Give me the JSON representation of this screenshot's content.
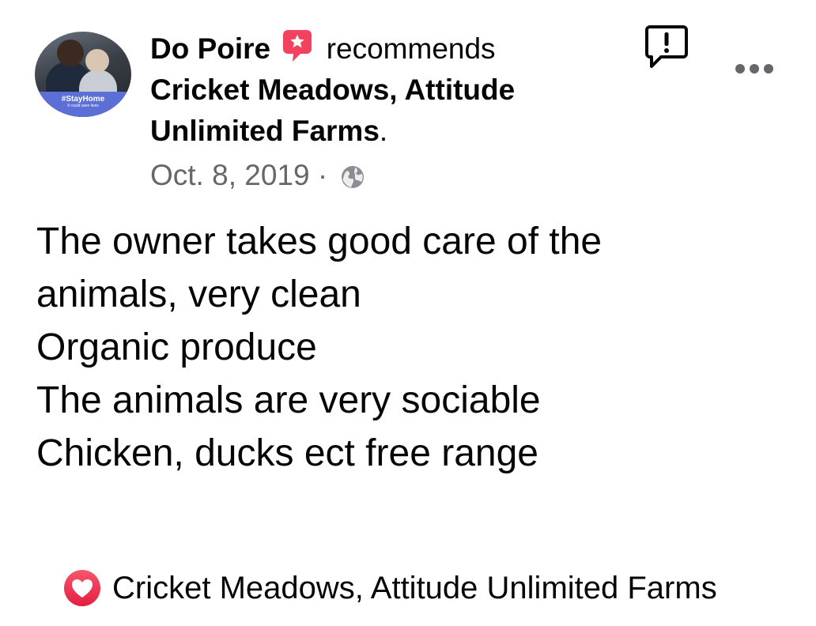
{
  "post": {
    "author": "Do Poire",
    "action": "recommends",
    "page_name": "Cricket Meadows, Attitude Unlimited Farms",
    "period": ".",
    "date": "Oct. 8, 2019",
    "separator": "·",
    "privacy_icon": "globe-icon",
    "avatar_badge": {
      "tag": "#StayHome",
      "sub": "It could save lives"
    },
    "body_lines": [
      "The owner takes good care of the",
      "animals, very clean",
      "Organic produce",
      "The animals are very sociable",
      "Chicken, ducks ect free range"
    ]
  },
  "footer": {
    "icon": "heart-icon",
    "page_link": "Cricket Meadows, Attitude Unlimited Farms"
  },
  "icons": {
    "recommend": "recommend-star-icon",
    "report": "report-icon",
    "more": "more-options-icon"
  },
  "colors": {
    "text": "#050505",
    "secondary": "#65676b",
    "recommend_red": "#f3425f",
    "badge_blue": "#5c6fd6"
  }
}
